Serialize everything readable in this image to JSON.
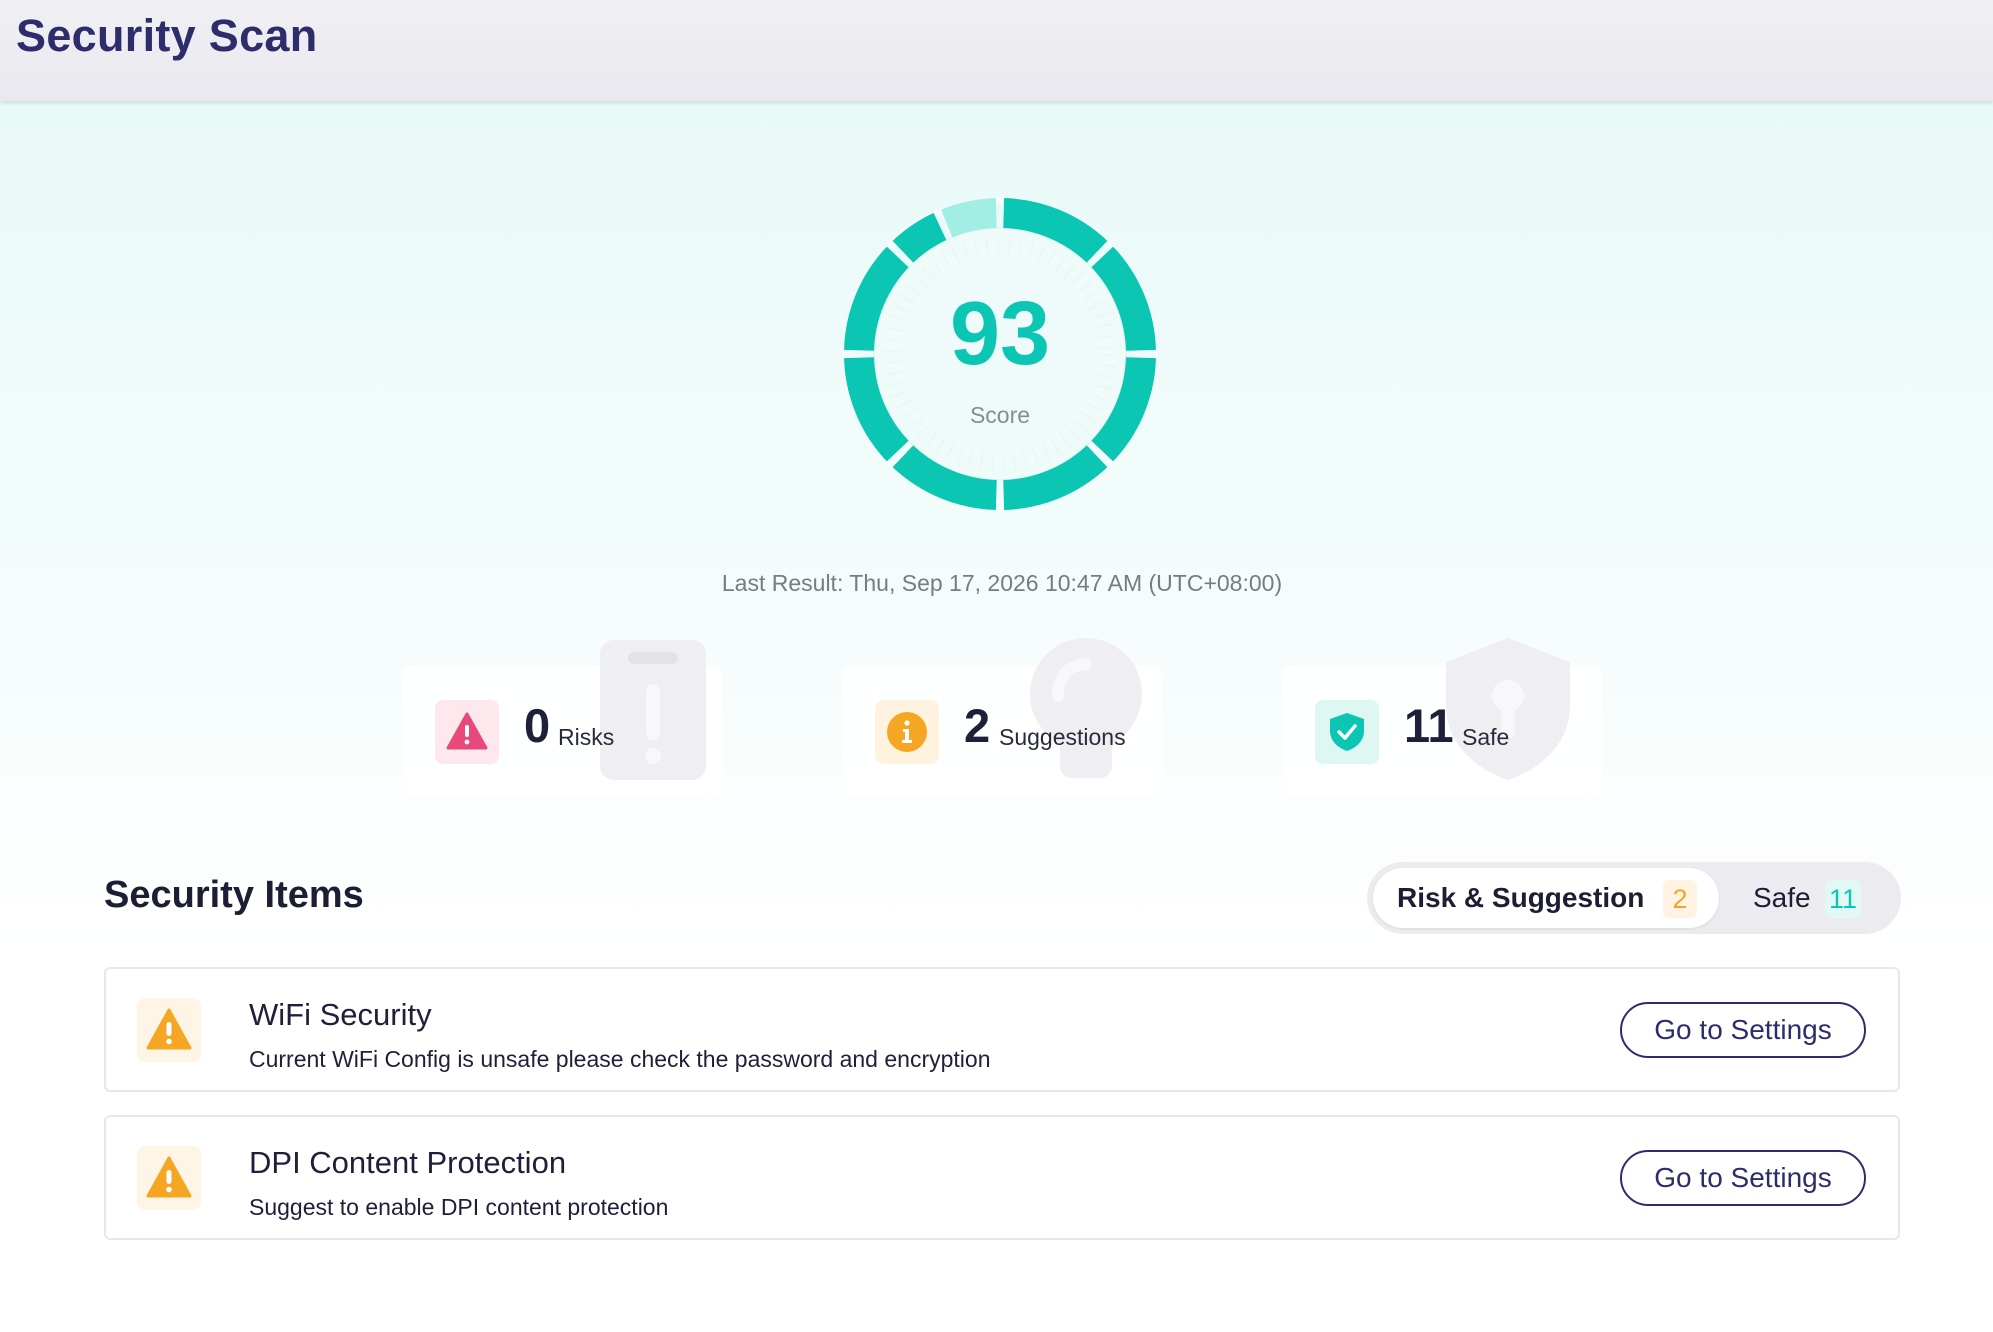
{
  "header": {
    "title": "Security Scan"
  },
  "score": {
    "value": "93",
    "label": "Score",
    "percent": 93,
    "accent_color": "#0cc6b4",
    "dim_color": "#a3eee4",
    "last_result": "Last Result: Thu, Sep 17, 2026 10:47 AM (UTC+08:00)"
  },
  "stats": {
    "risks": {
      "count": "0",
      "label": "Risks",
      "icon": "warning-triangle-icon",
      "color": "#e8497a"
    },
    "suggestions": {
      "count": "2",
      "label": "Suggestions",
      "icon": "info-circle-icon",
      "color": "#f5a623"
    },
    "safe": {
      "count": "11",
      "label": "Safe",
      "icon": "shield-check-icon",
      "color": "#0cc6b4"
    }
  },
  "security_items": {
    "title": "Security Items",
    "tabs": [
      {
        "label": "Risk & Suggestion",
        "count": "2",
        "active": true
      },
      {
        "label": "Safe",
        "count": "11",
        "active": false
      }
    ],
    "items": [
      {
        "title": "WiFi Security",
        "description": "Current WiFi Config is unsafe please check the password and encryption",
        "button": "Go to Settings",
        "icon": "warning-triangle-icon"
      },
      {
        "title": "DPI Content Protection",
        "description": "Suggest to enable DPI content protection",
        "button": "Go to Settings",
        "icon": "warning-triangle-icon"
      }
    ]
  }
}
